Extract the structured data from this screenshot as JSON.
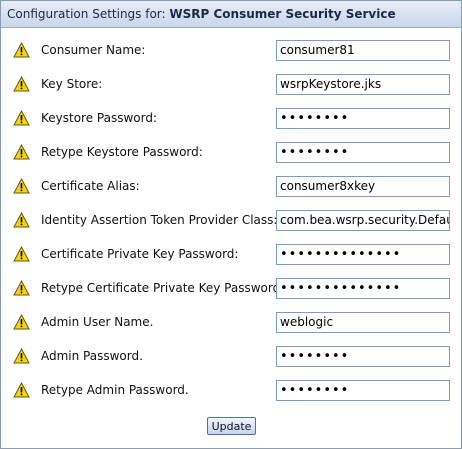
{
  "header": {
    "prefix": "Configuration Settings for:",
    "service_name": "WSRP Consumer Security Service"
  },
  "warning_icon": "warning-triangle-icon",
  "fields": [
    {
      "label": "Consumer Name:",
      "value": "consumer81",
      "type": "text"
    },
    {
      "label": "Key Store:",
      "value": "wsrpKeystore.jks",
      "type": "text"
    },
    {
      "label": "Keystore Password:",
      "value": "••••••••",
      "type": "password"
    },
    {
      "label": "Retype Keystore Password:",
      "value": "••••••••",
      "type": "password"
    },
    {
      "label": "Certificate Alias:",
      "value": "consumer8xkey",
      "type": "text"
    },
    {
      "label": "Identity Assertion Token Provider Class:",
      "value": "com.bea.wsrp.security.DefaultI",
      "type": "text"
    },
    {
      "label": "Certificate Private Key Password:",
      "value": "••••••••••••••",
      "type": "password"
    },
    {
      "label": "Retype Certificate Private Key Password:",
      "value": "••••••••••••••",
      "type": "password"
    },
    {
      "label": "Admin User Name.",
      "value": "weblogic",
      "type": "text"
    },
    {
      "label": "Admin Password.",
      "value": "••••••••",
      "type": "password"
    },
    {
      "label": "Retype Admin Password.",
      "value": "••••••••",
      "type": "password"
    }
  ],
  "update_button": "Update",
  "colors": {
    "warning": "#f2d21a",
    "header_bg": "#c9d7ea",
    "border": "#8c9cb0"
  }
}
